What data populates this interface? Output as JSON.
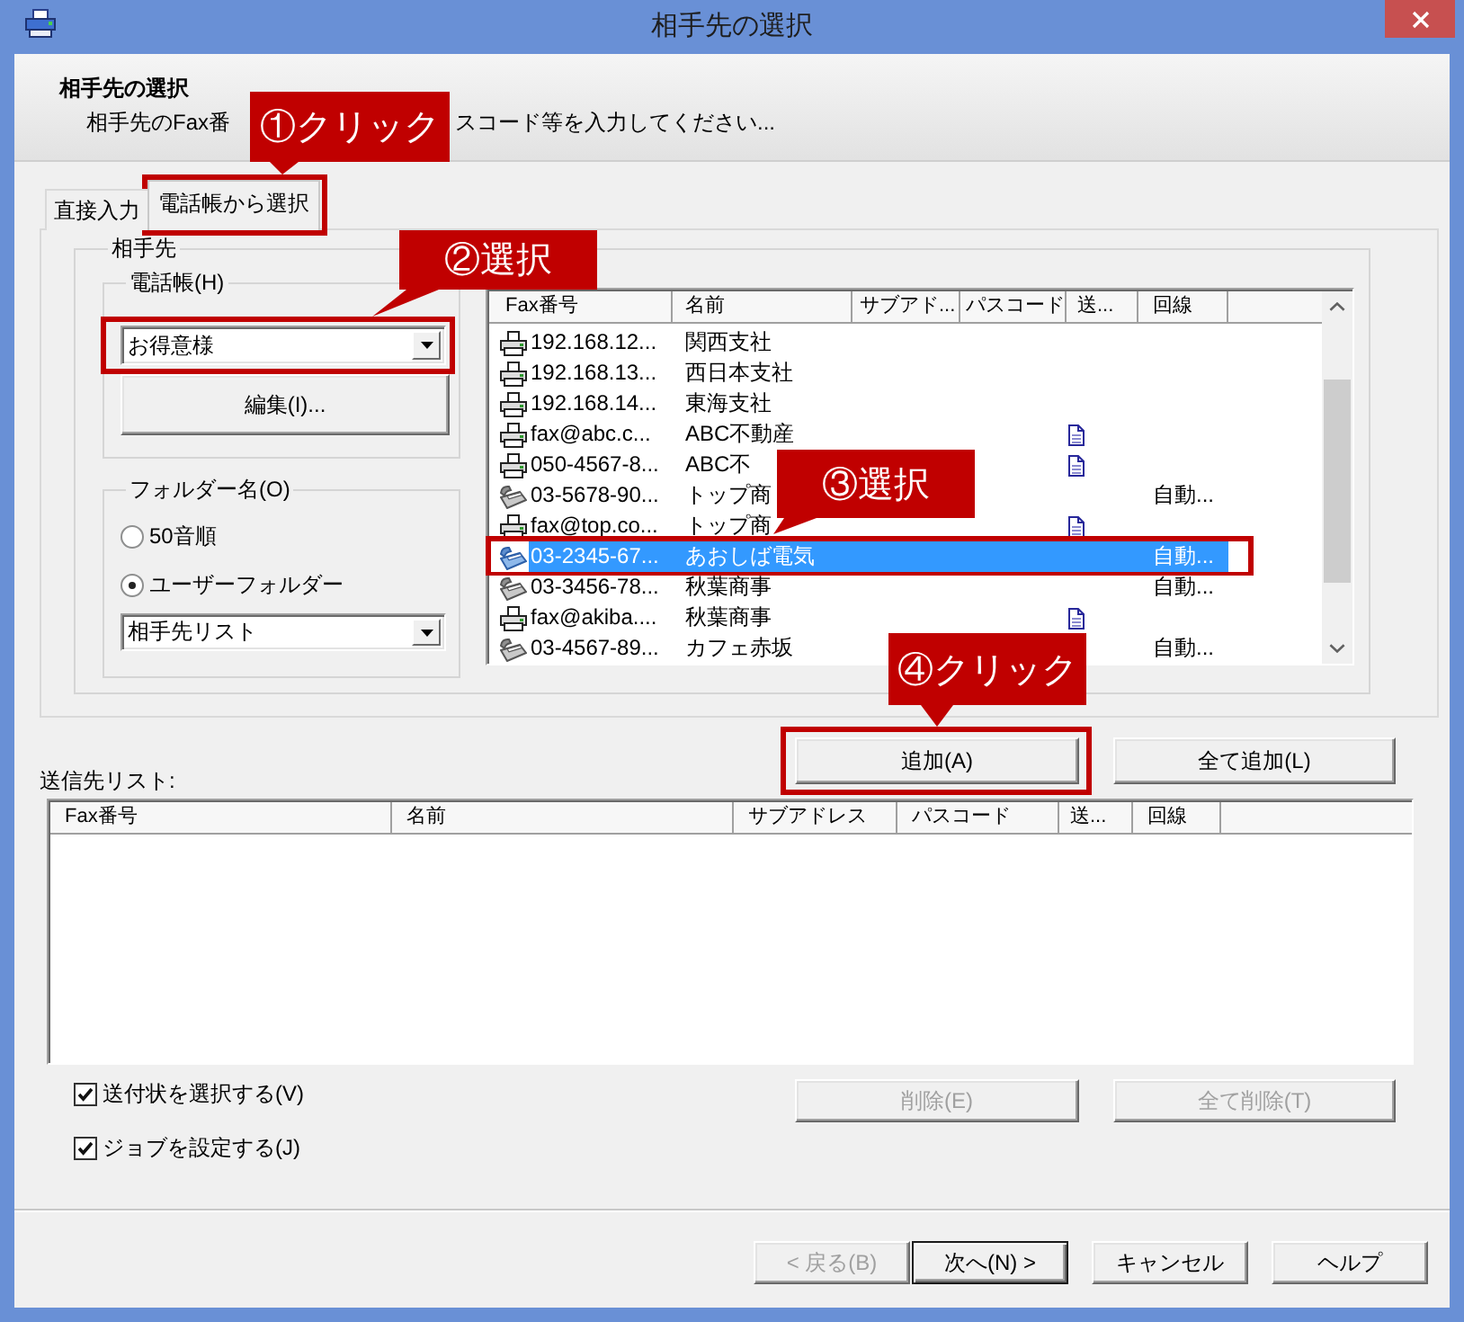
{
  "window": {
    "title": "相手先の選択"
  },
  "header": {
    "title": "相手先の選択",
    "description": [
      "相手先のFax番",
      "スコード等を入力してください..."
    ]
  },
  "tabs": [
    {
      "label": "直接入力",
      "selected": false
    },
    {
      "label": "電話帳から選択",
      "selected": true
    }
  ],
  "recipient": {
    "label": "相手先",
    "phonebook": {
      "label": "電話帳(H)",
      "value": "お得意様",
      "edit_button": "編集(I)..."
    },
    "folder": {
      "label": "フォルダー名(O)",
      "options": [
        {
          "label": "50音順",
          "selected": false
        },
        {
          "label": "ユーザーフォルダー",
          "selected": true
        }
      ],
      "value": "相手先リスト"
    },
    "table": {
      "columns": [
        "Fax番号",
        "名前",
        "サブアド...",
        "パスコード",
        "送...",
        "回線"
      ],
      "rows": [
        {
          "kind": "printer",
          "fax": "192.168.12...",
          "name": "関西支社",
          "column_5_icon": false,
          "selected": false
        },
        {
          "kind": "printer",
          "fax": "192.168.13...",
          "name": "西日本支社",
          "column_5_icon": false,
          "selected": false
        },
        {
          "kind": "printer",
          "fax": "192.168.14...",
          "name": "東海支社",
          "column_5_icon": false,
          "selected": false
        },
        {
          "kind": "printer",
          "fax": "fax@abc.c...",
          "name": "ABC不動産",
          "column_5_icon": true,
          "selected": false
        },
        {
          "kind": "printer",
          "fax": "050-4567-8...",
          "name": "ABC不",
          "column_5_icon": true,
          "selected": false
        },
        {
          "kind": "fax",
          "fax": "03-5678-90...",
          "name": "トップ商",
          "column_5_icon": false,
          "line": "自動...",
          "selected": false
        },
        {
          "kind": "printer",
          "fax": "fax@top.co...",
          "name": "トップ商",
          "column_5_icon": true,
          "selected": false
        },
        {
          "kind": "fax",
          "fax": "03-2345-67...",
          "name": "あおしば電気",
          "column_5_icon": false,
          "line": "自動...",
          "selected": true
        },
        {
          "kind": "fax",
          "fax": "03-3456-78...",
          "name": "秋葉商事",
          "column_5_icon": false,
          "line": "自動...",
          "selected": false
        },
        {
          "kind": "printer",
          "fax": "fax@akiba....",
          "name": "秋葉商事",
          "column_5_icon": true,
          "selected": false
        },
        {
          "kind": "fax",
          "fax": "03-4567-89...",
          "name": "カフェ赤坂",
          "column_5_icon": false,
          "line": "自動...",
          "selected": false
        }
      ]
    }
  },
  "add_buttons": [
    {
      "label": "追加(A)",
      "disabled": false
    },
    {
      "label": "全て追加(L)",
      "disabled": false
    }
  ],
  "send_list": {
    "label": "送信先リスト:",
    "columns": [
      "Fax番号",
      "名前",
      "サブアドレス",
      "パスコード",
      "送...",
      "回線"
    ]
  },
  "options": [
    {
      "label": "送付状を選択する(V)",
      "checked": true
    },
    {
      "label": "ジョブを設定する(J)",
      "checked": true
    }
  ],
  "remove_buttons": [
    {
      "label": "削除(E)",
      "disabled": true
    },
    {
      "label": "全て削除(T)",
      "disabled": true
    }
  ],
  "footer_buttons": [
    {
      "label": "< 戻る(B)",
      "disabled": true,
      "default": false
    },
    {
      "label": "次へ(N) >",
      "disabled": false,
      "default": true
    },
    {
      "label": "キャンセル",
      "disabled": false,
      "default": false
    },
    {
      "label": "ヘルプ",
      "disabled": false,
      "default": false
    }
  ],
  "callouts": [
    {
      "text": "①クリック"
    },
    {
      "text": "②選択"
    },
    {
      "text": "③選択"
    },
    {
      "text": "④クリック"
    }
  ]
}
